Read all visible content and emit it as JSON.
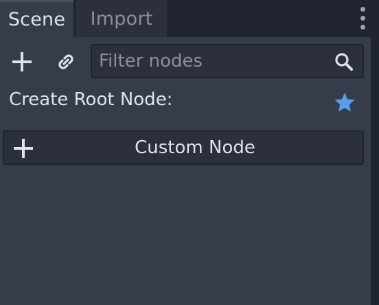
{
  "tabs": {
    "scene": "Scene",
    "import": "Import"
  },
  "toolbar": {
    "add_icon": "plus-icon",
    "link_icon": "link-icon",
    "menu_icon": "kebab-menu-icon"
  },
  "filter": {
    "placeholder": "Filter nodes",
    "value": "",
    "icon": "search-icon"
  },
  "create_root": {
    "label": "Create Root Node:",
    "favorite_icon": "star-icon",
    "custom_node_label": "Custom Node"
  },
  "colors": {
    "panel_bg": "#363d4a",
    "tab_bar_bg": "#202531",
    "accent_star": "#5c9be6",
    "text": "#dfe2e8"
  }
}
